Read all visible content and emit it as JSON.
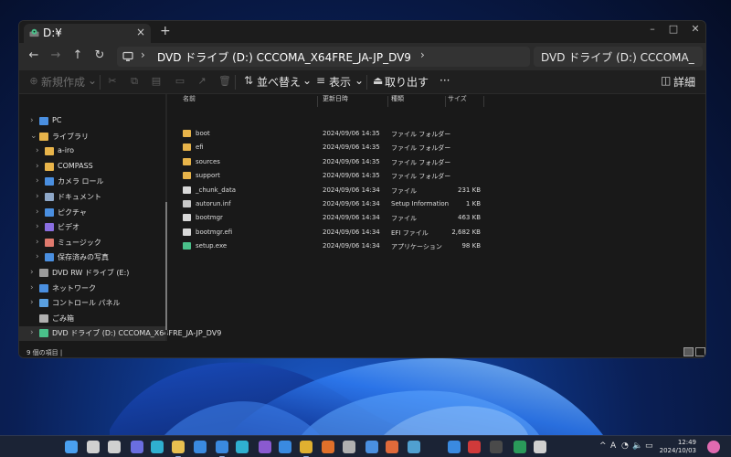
{
  "window": {
    "tab_title": "D:¥",
    "tab_close": "×",
    "new_tab": "+",
    "controls": {
      "minimize": "–",
      "maximize": "□",
      "close": "✕"
    }
  },
  "navbar": {
    "back": "←",
    "forward": "→",
    "up": "↑",
    "refresh": "↻",
    "breadcrumb": "DVD ドライブ (D:) CCCOMA_X64FRE_JA-JP_DV9",
    "breadcrumb_sep_1": "›",
    "breadcrumb_sep_2": "›",
    "search_text": "DVD ドライブ (D:) CCCOMA_"
  },
  "commandbar": {
    "new": "新規作成",
    "new_chev": "⌄",
    "sort": "並べ替え",
    "sort_chev": "⌄",
    "view": "表示",
    "view_chev": "⌄",
    "eject": "取り出す",
    "more": "···",
    "details": "詳細"
  },
  "navpane": {
    "items": [
      {
        "label": "PC",
        "chev": "›",
        "icon": "pc-icon",
        "color": "#4a8fe0"
      },
      {
        "label": "ライブラリ",
        "chev": "⌄",
        "icon": "library-icon",
        "color": "#e8b44a"
      },
      {
        "label": "a-iro",
        "chev": "›",
        "icon": "folder-icon",
        "color": "#e8b44a"
      },
      {
        "label": "COMPASS",
        "chev": "›",
        "icon": "folder-icon",
        "color": "#e8b44a"
      },
      {
        "label": "カメラ ロール",
        "chev": "›",
        "icon": "camera-roll-icon",
        "color": "#4a8fe0"
      },
      {
        "label": "ドキュメント",
        "chev": "›",
        "icon": "documents-icon",
        "color": "#8fa8c8"
      },
      {
        "label": "ピクチャ",
        "chev": "›",
        "icon": "pictures-icon",
        "color": "#4a8fe0"
      },
      {
        "label": "ビデオ",
        "chev": "›",
        "icon": "videos-icon",
        "color": "#8a6ee0"
      },
      {
        "label": "ミュージック",
        "chev": "›",
        "icon": "music-icon",
        "color": "#e07a6e"
      },
      {
        "label": "保存済みの写真",
        "chev": "›",
        "icon": "saved-pictures-icon",
        "color": "#4a8fe0"
      },
      {
        "label": "DVD RW ドライブ (E:)",
        "chev": "›",
        "icon": "dvd-rw-icon",
        "color": "#9a9a9a"
      },
      {
        "label": "ネットワーク",
        "chev": "›",
        "icon": "network-icon",
        "color": "#4a8fe0"
      },
      {
        "label": "コントロール パネル",
        "chev": "›",
        "icon": "control-panel-icon",
        "color": "#5aa0e0"
      },
      {
        "label": "ごみ箱",
        "chev": "",
        "icon": "recycle-bin-icon",
        "color": "#b0b0b0"
      },
      {
        "label": "DVD ドライブ (D:) CCCOMA_X64FRE_JA-JP_DV9",
        "chev": "›",
        "icon": "dvd-drive-icon",
        "color": "#4ac08a"
      }
    ]
  },
  "filelist": {
    "headers": {
      "name": "名前",
      "date": "更新日時",
      "type": "種類",
      "size": "サイズ"
    },
    "rows": [
      {
        "name": "boot",
        "date": "2024/09/06 14:35",
        "type": "ファイル フォルダー",
        "size": "",
        "icon": "folder-icon",
        "color": "#e8b44a"
      },
      {
        "name": "efi",
        "date": "2024/09/06 14:35",
        "type": "ファイル フォルダー",
        "size": "",
        "icon": "folder-icon",
        "color": "#e8b44a"
      },
      {
        "name": "sources",
        "date": "2024/09/06 14:35",
        "type": "ファイル フォルダー",
        "size": "",
        "icon": "folder-icon",
        "color": "#e8b44a"
      },
      {
        "name": "support",
        "date": "2024/09/06 14:35",
        "type": "ファイル フォルダー",
        "size": "",
        "icon": "folder-icon",
        "color": "#e8b44a"
      },
      {
        "name": "_chunk_data",
        "date": "2024/09/06 14:34",
        "type": "ファイル",
        "size": "231 KB",
        "icon": "file-icon",
        "color": "#d8d8d8"
      },
      {
        "name": "autorun.inf",
        "date": "2024/09/06 14:34",
        "type": "Setup Information",
        "size": "1 KB",
        "icon": "settings-file-icon",
        "color": "#c8c8c8"
      },
      {
        "name": "bootmgr",
        "date": "2024/09/06 14:34",
        "type": "ファイル",
        "size": "463 KB",
        "icon": "file-icon",
        "color": "#d8d8d8"
      },
      {
        "name": "bootmgr.efi",
        "date": "2024/09/06 14:34",
        "type": "EFI ファイル",
        "size": "2,682 KB",
        "icon": "file-icon",
        "color": "#d8d8d8"
      },
      {
        "name": "setup.exe",
        "date": "2024/09/06 14:34",
        "type": "アプリケーション",
        "size": "98 KB",
        "icon": "setup-exe-icon",
        "color": "#4ac08a"
      }
    ]
  },
  "statusbar": {
    "text": "9 個の項目  |"
  },
  "taskbar": {
    "icons": [
      {
        "name": "start-icon",
        "color": "#4aa0f0",
        "running": false
      },
      {
        "name": "search-icon",
        "color": "#d0d0d0",
        "running": false
      },
      {
        "name": "task-view-icon",
        "color": "#d0d0d0",
        "running": false
      },
      {
        "name": "teams-icon",
        "color": "#6a6ee0",
        "running": false
      },
      {
        "name": "edge-icon",
        "color": "#2fb0d0",
        "running": false
      },
      {
        "name": "file-explorer-icon",
        "color": "#e8c050",
        "running": true
      },
      {
        "name": "mail-icon",
        "color": "#3a8ae0",
        "running": false
      },
      {
        "name": "remote-desktop-icon",
        "color": "#3a8ae0",
        "running": true
      },
      {
        "name": "edge-dev-icon",
        "color": "#2fb0d0",
        "running": false
      },
      {
        "name": "visual-studio-icon",
        "color": "#8a5ad0",
        "running": false
      },
      {
        "name": "store-icon",
        "color": "#3a8ae0",
        "running": false
      },
      {
        "name": "chrome-icon",
        "color": "#e0b030",
        "running": true
      },
      {
        "name": "firefox-icon",
        "color": "#e0702a",
        "running": false
      },
      {
        "name": "settings-icon",
        "color": "#b0b0b0",
        "running": false
      },
      {
        "name": "photos-icon",
        "color": "#4a90e0",
        "running": false
      },
      {
        "name": "media-player-icon",
        "color": "#e06a3a",
        "running": false
      },
      {
        "name": "network-tool-icon",
        "color": "#50a0d0",
        "running": false
      },
      {
        "name": "todo-icon",
        "color": "#3a8ae0",
        "running": false
      },
      {
        "name": "acrobat-icon",
        "color": "#d03a3a",
        "running": false
      },
      {
        "name": "terminal-icon",
        "color": "#4a4a4a",
        "running": false
      },
      {
        "name": "excel-icon",
        "color": "#2a9a5a",
        "running": false
      },
      {
        "name": "overflow-icon",
        "color": "#d0d0d0",
        "running": false
      }
    ],
    "tray": {
      "chevron": "^",
      "ime": "A",
      "wifi": "◔",
      "volume": "🔈",
      "battery": "▭"
    },
    "clock": {
      "time": "12:49",
      "date": "2024/10/03"
    }
  }
}
